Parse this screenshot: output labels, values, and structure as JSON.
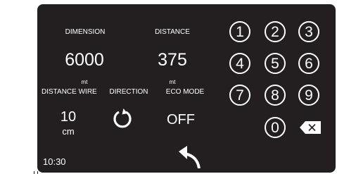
{
  "labels": {
    "dimension": "DIMENSION",
    "distance": "DISTANCE",
    "distance_wire": "DISTANCE WIRE",
    "direction": "DIRECTION",
    "eco_mode": "ECO MODE"
  },
  "values": {
    "dimension": "6000",
    "dimension_unit": "mt",
    "distance": "375",
    "distance_unit": "mt",
    "distance_wire": "10",
    "distance_wire_unit": "cm",
    "eco_mode": "OFF"
  },
  "keypad": {
    "keys": [
      "1",
      "2",
      "3",
      "4",
      "5",
      "6",
      "7",
      "8",
      "9",
      "0"
    ]
  },
  "clock": "10:30",
  "icons": {
    "direction": "rotate-icon",
    "back": "back-arrow-icon",
    "backspace": "backspace-icon"
  },
  "colors": {
    "screen_bg": "#231f20",
    "foreground": "#ffffff"
  }
}
